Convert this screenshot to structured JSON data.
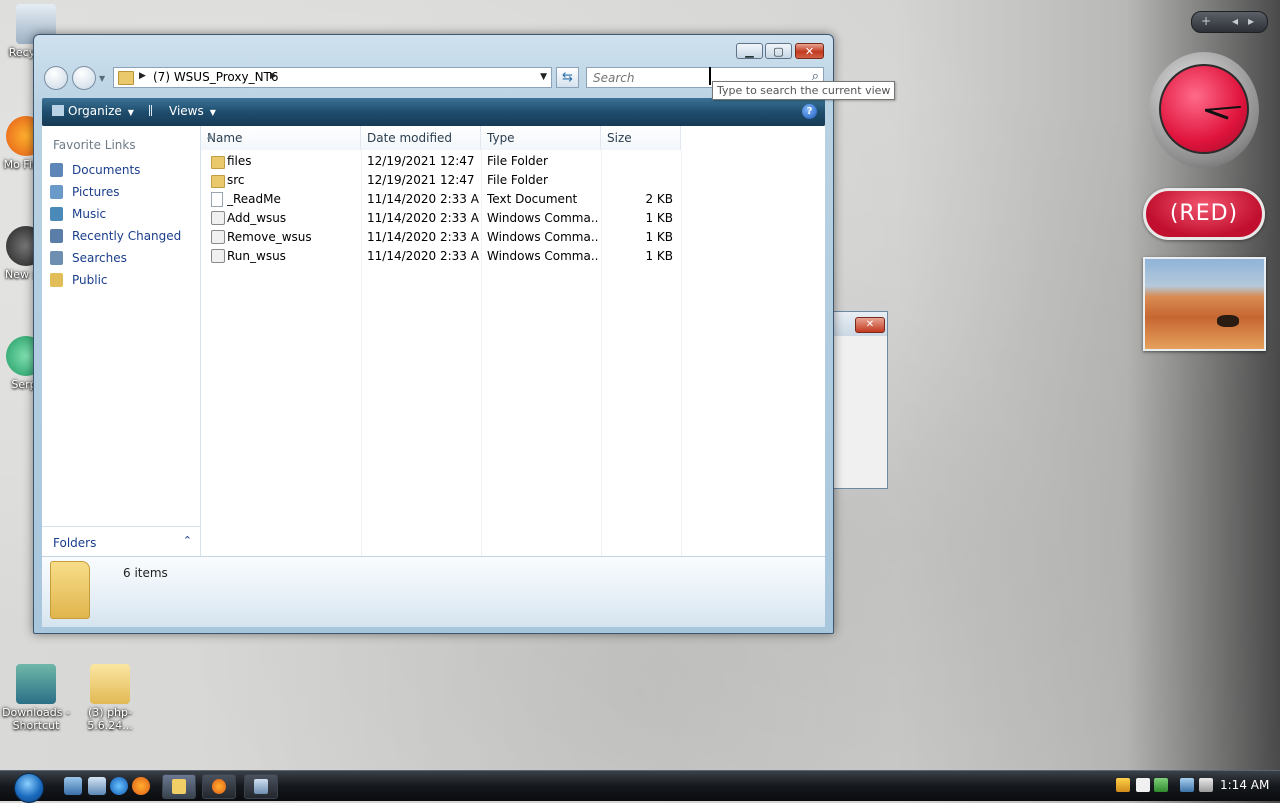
{
  "desktop": {
    "icons": [
      {
        "label": "Recy"
      },
      {
        "label": "Mo Fir"
      },
      {
        "label": "New x"
      },
      {
        "label": "Serp"
      },
      {
        "label": "Downloads - Shortcut"
      },
      {
        "label": "(3) php-5.6.24..."
      }
    ]
  },
  "window": {
    "address": {
      "crumb": "(7) WSUS_Proxy_NT6"
    },
    "search": {
      "placeholder": "Search"
    },
    "tooltip": "Type to search the current view",
    "toolbar": {
      "organize": "Organize",
      "views": "Views"
    },
    "nav": {
      "title": "Favorite Links",
      "items": [
        {
          "label": "Documents",
          "icon": "documents-icon",
          "color": "#5f86b8"
        },
        {
          "label": "Pictures",
          "icon": "pictures-icon",
          "color": "#6a9ac9"
        },
        {
          "label": "Music",
          "icon": "music-icon",
          "color": "#4a8ab8"
        },
        {
          "label": "Recently Changed",
          "icon": "recently-changed-icon",
          "color": "#5a7ea8"
        },
        {
          "label": "Searches",
          "icon": "searches-icon",
          "color": "#6f8fb2"
        },
        {
          "label": "Public",
          "icon": "public-folder-icon",
          "color": "#e3bd57"
        }
      ],
      "folders_label": "Folders"
    },
    "columns": [
      "Name",
      "Date modified",
      "Type",
      "Size"
    ],
    "files": [
      {
        "name": "files",
        "date": "12/19/2021 12:47 ...",
        "type": "File Folder",
        "size": "",
        "kind": "folder"
      },
      {
        "name": "src",
        "date": "12/19/2021 12:47 ...",
        "type": "File Folder",
        "size": "",
        "kind": "folder"
      },
      {
        "name": "_ReadMe",
        "date": "11/14/2020 2:33 AM",
        "type": "Text Document",
        "size": "2 KB",
        "kind": "txt"
      },
      {
        "name": "Add_wsus",
        "date": "11/14/2020 2:33 AM",
        "type": "Windows Comma...",
        "size": "1 KB",
        "kind": "cmd"
      },
      {
        "name": "Remove_wsus",
        "date": "11/14/2020 2:33 AM",
        "type": "Windows Comma...",
        "size": "1 KB",
        "kind": "cmd"
      },
      {
        "name": "Run_wsus",
        "date": "11/14/2020 2:33 AM",
        "type": "Windows Comma...",
        "size": "1 KB",
        "kind": "cmd"
      }
    ],
    "details": {
      "count": "6 items"
    }
  },
  "gadgets": {
    "red_label": "(RED)"
  },
  "taskbar": {
    "time": "1:14 AM"
  }
}
